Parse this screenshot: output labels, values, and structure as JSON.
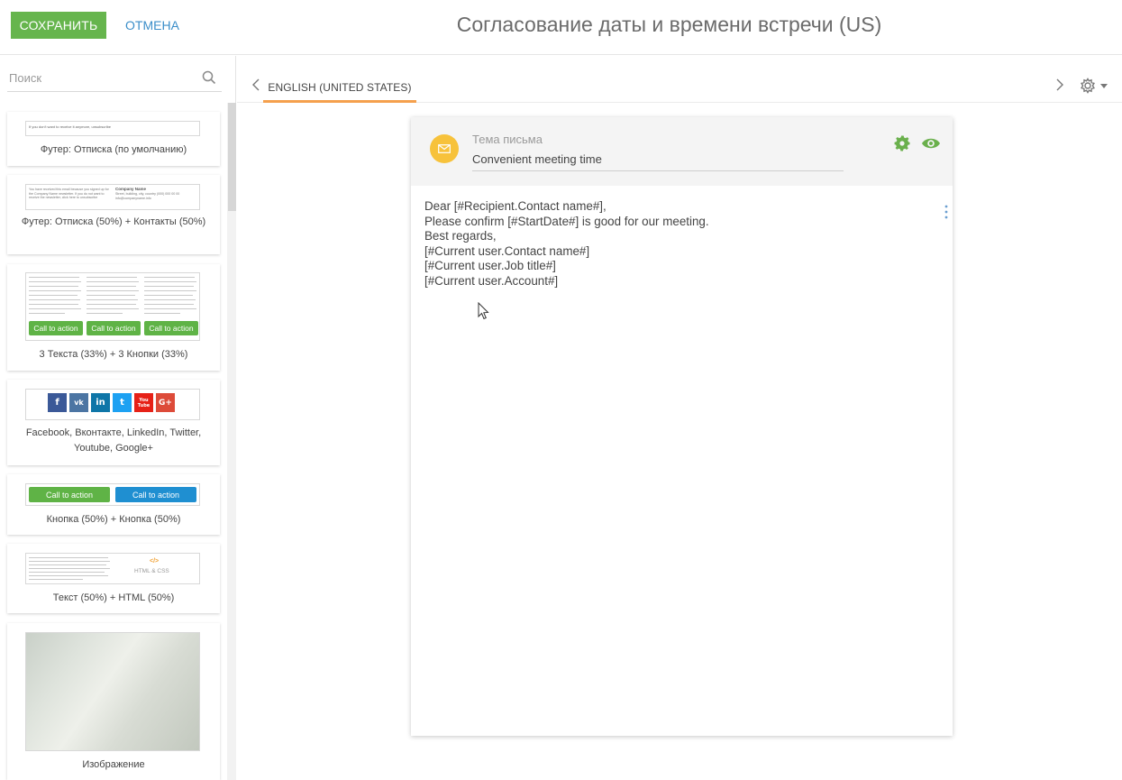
{
  "toolbar": {
    "save_label": "СОХРАНИТЬ",
    "cancel_label": "ОТМЕНА"
  },
  "page_title": "Согласование даты и времени встречи (US)",
  "sidebar": {
    "search_placeholder": "Поиск",
    "blocks": [
      {
        "label": "Футер: Отписка (по умолчанию)",
        "thumb_text": "If you don't want to receive it anymore, unsubscribe"
      },
      {
        "label": "Футер: Отписка (50%) + Контакты (50%)",
        "thumb_left": "You have received this email because you signed up for the Company Name newsletter. If you do not want to receive the newsletter, click here to unsubscribe",
        "thumb_company": "Company Name",
        "thumb_right": "Street, building, city, country (000) 000 00 00 info@companyname.info"
      },
      {
        "label": "3 Текста (33%) + 3 Кнопки (33%)",
        "cta": [
          "Call to action",
          "Call to action",
          "Call to action"
        ]
      },
      {
        "label": "Facebook, Вконтакте, LinkedIn, Twitter, Youtube, Google+",
        "icons": [
          "f",
          "vk",
          "in",
          "t",
          "You Tube",
          "G+"
        ]
      },
      {
        "label": "Кнопка (50%) + Кнопка (50%)",
        "cta": [
          "Call to action",
          "Call to action"
        ]
      },
      {
        "label": "Текст (50%) + HTML (50%)",
        "html_code": "</>",
        "html_text": "HTML & CSS"
      },
      {
        "label": "Изображение"
      }
    ]
  },
  "editor": {
    "tab_label": "ENGLISH (UNITED STATES)",
    "subject_label": "Тема письма",
    "subject_value": "Convenient meeting time",
    "body_lines": [
      "Dear [#Recipient.Contact name#],",
      "Please confirm [#StartDate#] is good for our meeting.",
      "Best regards,",
      "[#Current user.Contact name#]",
      "[#Current user.Job title#]",
      "[#Current user.Account#]"
    ]
  },
  "colors": {
    "save_button": "#66b54d",
    "cancel_link": "#3b8ec9",
    "tab_underline": "#f5a04d",
    "mail_icon_bg": "#f7c23b",
    "cta_green": "#5fb346",
    "cta_blue": "#1f8fd1",
    "settings_green": "#6ab04c"
  }
}
